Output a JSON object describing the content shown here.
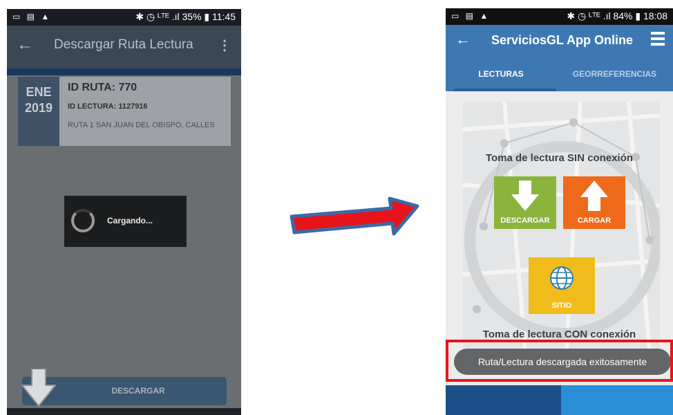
{
  "left_phone": {
    "status_bar": {
      "left_icons": "▭ ▤ ▲",
      "right": "✱ ◷ ᴸᵀᴱ .ıl 35% ▮ 11:45"
    },
    "app_bar": {
      "title": "Descargar Ruta Lectura",
      "back_icon": "arrow-left-icon",
      "menu_icon": "more-vert-icon"
    },
    "card": {
      "month": "ENE",
      "year": "2019",
      "id_ruta": "ID RUTA: 770",
      "id_lectura": "ID LECTURA: 1127916",
      "description": "RUTA 1 SAN JUAN DEL OBISPO, CALLES"
    },
    "dialog": {
      "text": "Cargando..."
    },
    "download_button": {
      "label": "DESCARGAR"
    }
  },
  "right_phone": {
    "status_bar": {
      "left_icons": "▭ ▤ ▲",
      "right": "✱ ◷ ᴸᵀᴱ .ıl 84% ▮ 18:08"
    },
    "app_bar": {
      "title": "ServiciosGL App Online",
      "back_icon": "arrow-left-icon",
      "menu_icon": "hamburger-menu-icon"
    },
    "tabs": [
      {
        "label": "LECTURAS"
      },
      {
        "label": "GEORREFERENCIAS"
      }
    ],
    "section_offline": "Toma de lectura SIN conexión",
    "tiles": [
      {
        "label": "DESCARGAR",
        "color": "#8bb43c",
        "icon": "arrow-down-icon"
      },
      {
        "label": "CARGAR",
        "color": "#ee6a1a",
        "icon": "arrow-up-icon"
      },
      {
        "label": "SITIO",
        "color": "#efbc1c",
        "icon": "globe-icon"
      }
    ],
    "section_online": "Toma de lectura CON conexión",
    "toast": "Ruta/Lectura descargada exitosamente"
  },
  "colors": {
    "highlight": "#e8141c",
    "arrow_fill": "#e8141c",
    "arrow_border": "#3a6aa8",
    "accent_blue": "#3e78b3"
  }
}
